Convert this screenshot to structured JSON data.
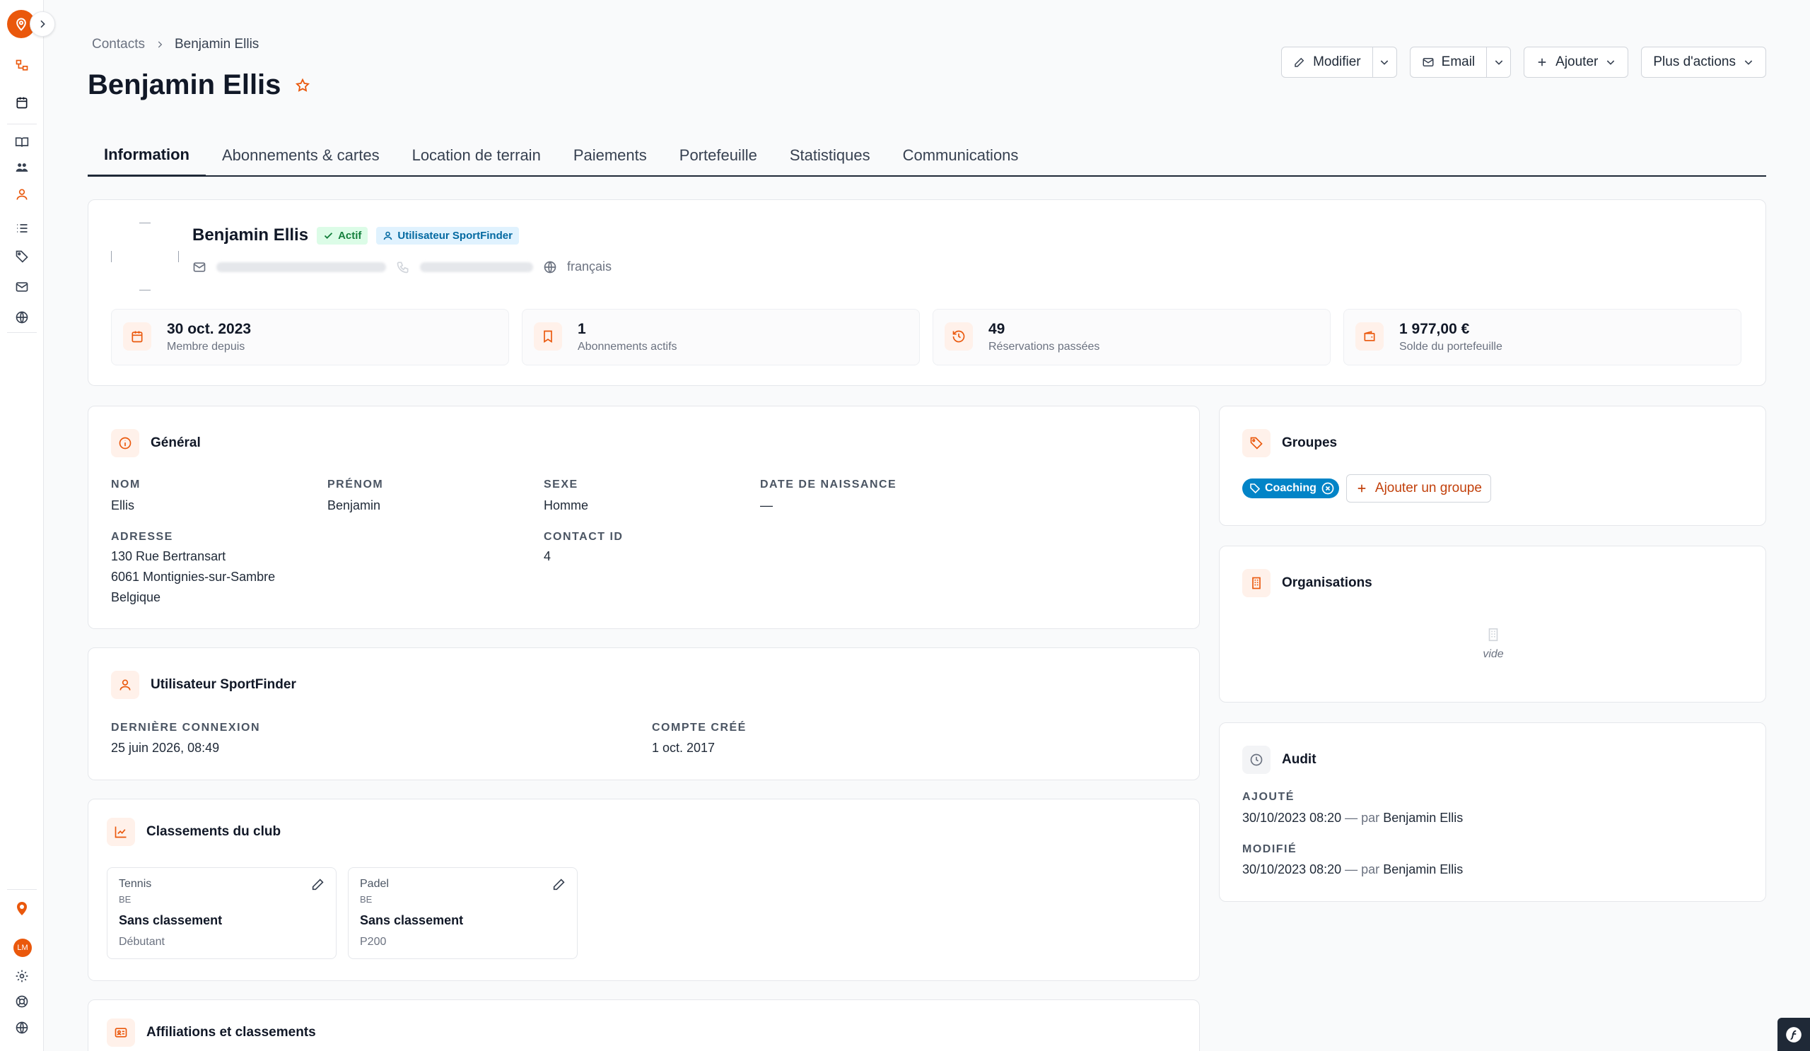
{
  "sidebar": {
    "logo_icon": "map-pin-icon",
    "collapse_icon": "chevron-right-icon",
    "avatar_initials": "LM",
    "accent": "#ea580c"
  },
  "breadcrumb": {
    "parent": "Contacts",
    "current": "Benjamin Ellis"
  },
  "header": {
    "title": "Benjamin Ellis",
    "buttons": {
      "edit": "Modifier",
      "email": "Email",
      "add": "Ajouter",
      "more": "Plus d'actions"
    }
  },
  "tabs": [
    {
      "label": "Information",
      "active": true
    },
    {
      "label": "Abonnements & cartes"
    },
    {
      "label": "Location de terrain"
    },
    {
      "label": "Paiements"
    },
    {
      "label": "Portefeuille"
    },
    {
      "label": "Statistiques"
    },
    {
      "label": "Communications"
    }
  ],
  "profile": {
    "name": "Benjamin Ellis",
    "status_badge": "Actif",
    "user_badge": "Utilisateur SportFinder",
    "language": "français"
  },
  "stats": [
    {
      "value": "30 oct. 2023",
      "label": "Membre depuis"
    },
    {
      "value": "1",
      "label": "Abonnements actifs"
    },
    {
      "value": "49",
      "label": "Réservations passées"
    },
    {
      "value": "1 977,00 €",
      "label": "Solde du portefeuille"
    }
  ],
  "general": {
    "title": "Général",
    "nom_label": "NOM",
    "nom": "Ellis",
    "prenom_label": "PRÉNOM",
    "prenom": "Benjamin",
    "sexe_label": "SEXE",
    "sexe": "Homme",
    "naissance_label": "DATE DE NAISSANCE",
    "naissance": "—",
    "adresse_label": "ADRESSE",
    "adresse_1": "130 Rue Bertransart",
    "adresse_2": "6061 Montignies-sur-Sambre",
    "adresse_3": "Belgique",
    "contact_id_label": "CONTACT ID",
    "contact_id": "4"
  },
  "sportfinder": {
    "title": "Utilisateur SportFinder",
    "last_login_label": "DERNIÈRE CONNEXION",
    "last_login": "25 juin 2026, 08:49",
    "created_label": "COMPTE CRÉÉ",
    "created": "1 oct. 2017"
  },
  "rankings": {
    "title": "Classements du club",
    "items": [
      {
        "sport": "Tennis",
        "country": "BE",
        "rank": "Sans classement",
        "level": "Débutant"
      },
      {
        "sport": "Padel",
        "country": "BE",
        "rank": "Sans classement",
        "level": "P200"
      }
    ]
  },
  "affiliations": {
    "title": "Affiliations et classements"
  },
  "groups": {
    "title": "Groupes",
    "tags": [
      "Coaching"
    ],
    "add_label": "Ajouter un groupe",
    "tag_color": "#0284c7"
  },
  "organisations": {
    "title": "Organisations",
    "empty": "vide"
  },
  "audit": {
    "title": "Audit",
    "added_label": "AJOUTÉ",
    "added_date": "30/10/2023 08:20",
    "added_by_prefix": "— par",
    "added_by": "Benjamin Ellis",
    "modified_label": "MODIFIÉ",
    "modified_date": "30/10/2023 08:20",
    "modified_by_prefix": "— par",
    "modified_by": "Benjamin Ellis"
  }
}
